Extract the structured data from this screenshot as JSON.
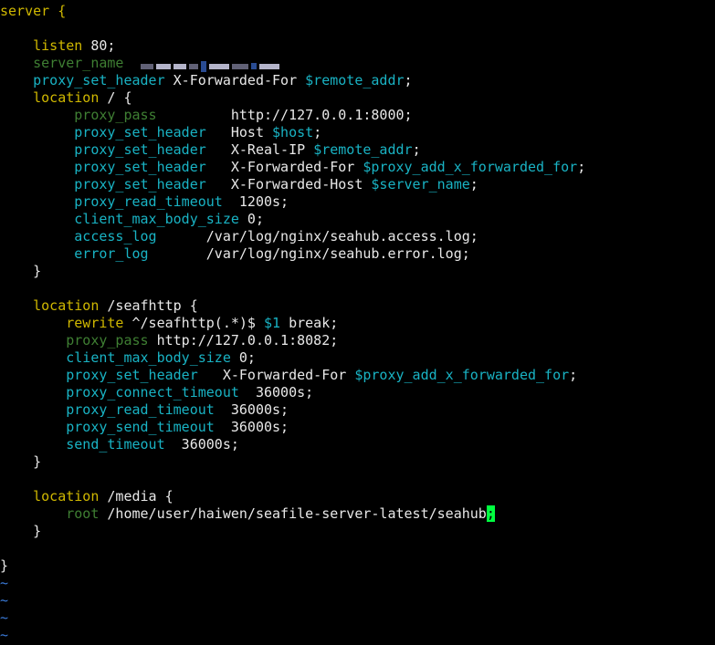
{
  "editor": {
    "theme": {
      "background": "#000000",
      "keyword_color": "#d0b800",
      "directive_color": "#19b3c4",
      "comment_color": "#3f7f33",
      "text_color": "#e8e8e8",
      "cursor_color": "#00ff40",
      "tilde_color": "#3a7ad8"
    },
    "lines": {
      "l01": {
        "kw": "server {"
      },
      "l03": {
        "dir": "listen",
        "val": " 80;"
      },
      "l04": {
        "dir": "server_name"
      },
      "l05": {
        "dir": "proxy_set_header",
        "val": " X-Forwarded-For ",
        "var": "$remote_addr",
        "end": ";"
      },
      "l06": {
        "kw": "location",
        "val": " / {"
      },
      "l07": {
        "dir": "proxy_pass",
        "val": "         http://127.0.0.1:8000;"
      },
      "l08": {
        "dir": "proxy_set_header",
        "val": "   Host ",
        "var": "$host",
        "end": ";"
      },
      "l09": {
        "dir": "proxy_set_header",
        "val": "   X-Real-IP ",
        "var": "$remote_addr",
        "end": ";"
      },
      "l10": {
        "dir": "proxy_set_header",
        "val": "   X-Forwarded-For ",
        "var": "$proxy_add_x_forwarded_for",
        "end": ";"
      },
      "l11": {
        "dir": "proxy_set_header",
        "val": "   X-Forwarded-Host ",
        "var": "$server_name",
        "end": ";"
      },
      "l12": {
        "dir": "proxy_read_timeout",
        "val": "  1200s;"
      },
      "l13": {
        "dir": "client_max_body_size",
        "val": " 0;"
      },
      "l14": {
        "dir": "access_log",
        "val": "      /var/log/nginx/seahub.access.log;"
      },
      "l15": {
        "dir": "error_log",
        "val": "       /var/log/nginx/seahub.error.log;"
      },
      "l16": {
        "val": "}"
      },
      "l18": {
        "kw": "location",
        "val": " /seafhttp {"
      },
      "l19": {
        "dir": "rewrite",
        "val": " ^/seafhttp(.*)$ ",
        "var": "$1",
        "end": " break;"
      },
      "l20": {
        "dir": "proxy_pass",
        "val": " http://127.0.0.1:8082;"
      },
      "l21": {
        "dir": "client_max_body_size",
        "val": " 0;"
      },
      "l22": {
        "dir": "proxy_set_header",
        "val": "   X-Forwarded-For ",
        "var": "$proxy_add_x_forwarded_for",
        "end": ";"
      },
      "l23": {
        "dir": "proxy_connect_timeout",
        "val": "  36000s;"
      },
      "l24": {
        "dir": "proxy_read_timeout",
        "val": "  36000s;"
      },
      "l25": {
        "dir": "proxy_send_timeout",
        "val": "  36000s;"
      },
      "l26": {
        "dir": "send_timeout",
        "val": "  36000s;"
      },
      "l27": {
        "val": "}"
      },
      "l29": {
        "kw": "location",
        "val": " /media {"
      },
      "l30": {
        "dir": "root",
        "val": " /home/user/haiwen/seafile-server-latest/seahub",
        "cursor": ";"
      },
      "l31": {
        "val": "}"
      },
      "l33": {
        "val": "}"
      },
      "tilde": "~"
    }
  }
}
